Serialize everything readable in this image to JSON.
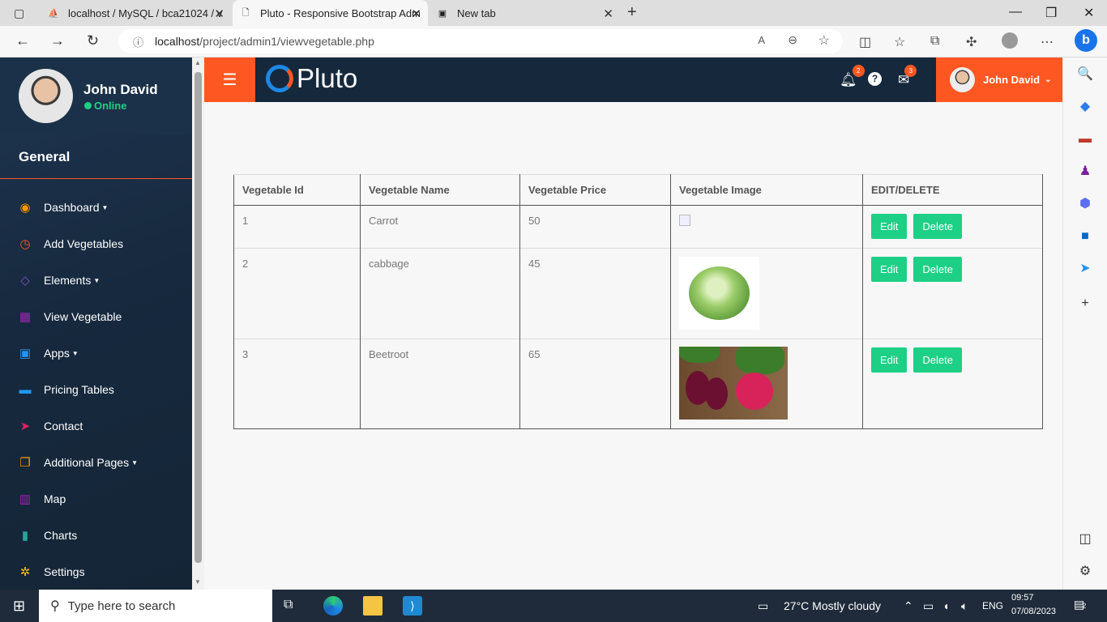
{
  "browser": {
    "tabs": [
      {
        "label": "localhost / MySQL / bca21024 / v",
        "icon": "phpmyadmin-icon"
      },
      {
        "label": "Pluto - Responsive Bootstrap Adm",
        "icon": "page-icon"
      },
      {
        "label": "New tab",
        "icon": "new-tab-icon"
      }
    ],
    "url_host": "localhost",
    "url_path": "/project/admin1/viewvegetable.php"
  },
  "sidebar": {
    "user_name": "John David",
    "user_status": "Online",
    "section": "General",
    "items": [
      {
        "label": "Dashboard",
        "icon": "dashboard-icon",
        "color": "#ff9800",
        "dropdown": true
      },
      {
        "label": "Add Vegetables",
        "icon": "clock-icon",
        "color": "#ff5722",
        "dropdown": false
      },
      {
        "label": "Elements",
        "icon": "diamond-icon",
        "color": "#7e57c2",
        "dropdown": true
      },
      {
        "label": "View Vegetable",
        "icon": "table-icon",
        "color": "#9c27b0",
        "dropdown": false
      },
      {
        "label": "Apps",
        "icon": "apps-icon",
        "color": "#2196f3",
        "dropdown": true
      },
      {
        "label": "Pricing Tables",
        "icon": "briefcase-icon",
        "color": "#2196f3",
        "dropdown": false
      },
      {
        "label": "Contact",
        "icon": "paper-plane-icon",
        "color": "#e91e63",
        "dropdown": false
      },
      {
        "label": "Additional Pages",
        "icon": "clone-icon",
        "color": "#ff9800",
        "dropdown": true
      },
      {
        "label": "Map",
        "icon": "map-icon",
        "color": "#9c27b0",
        "dropdown": false
      },
      {
        "label": "Charts",
        "icon": "bar-chart-icon",
        "color": "#26a69a",
        "dropdown": false
      },
      {
        "label": "Settings",
        "icon": "gear-icon",
        "color": "#ffc107",
        "dropdown": false
      }
    ]
  },
  "header": {
    "logo_text": "Pluto",
    "notifications_count": "2",
    "messages_count": "3",
    "user_name": "John David"
  },
  "table": {
    "headers": [
      "Vegetable Id",
      "Vegetable Name",
      "Vegetable Price",
      "Vegetable Image",
      "EDIT/DELETE"
    ],
    "rows": [
      {
        "id": "1",
        "name": "Carrot",
        "price": "50",
        "image": "broken-image"
      },
      {
        "id": "2",
        "name": "cabbage",
        "price": "45",
        "image": "cabbage-photo"
      },
      {
        "id": "3",
        "name": "Beetroot",
        "price": "65",
        "image": "beetroot-photo"
      }
    ],
    "edit_label": "Edit",
    "delete_label": "Delete"
  },
  "taskbar": {
    "search_placeholder": "Type here to search",
    "weather": "27°C  Mostly cloudy",
    "language": "ENG",
    "time": "09:57",
    "date": "07/08/2023",
    "notification_count": "2"
  },
  "colors": {
    "accent": "#ff5722",
    "header": "#15283c",
    "success": "#1ed085"
  }
}
